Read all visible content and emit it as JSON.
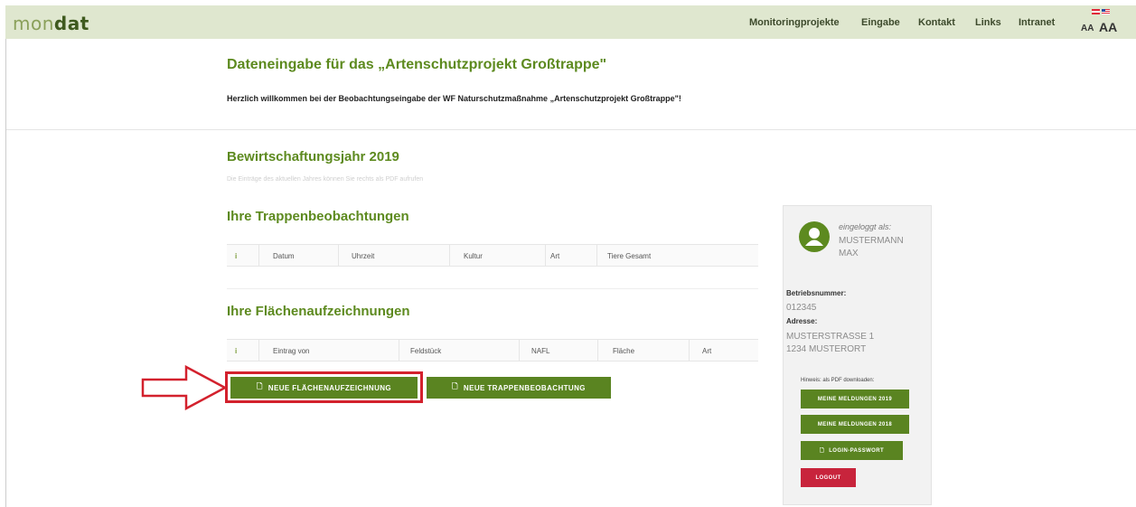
{
  "colors": {
    "accent": "#5d8a1f",
    "button": "#5a8421",
    "logout": "#c8243c",
    "highlight": "#d3212d",
    "topbar": "#dfe7cf"
  },
  "logo": {
    "part1": "mon",
    "part2": "dat"
  },
  "nav": [
    "Monitoringprojekte",
    "Eingabe",
    "Kontakt",
    "Links",
    "Intranet"
  ],
  "font_size": {
    "small": "AA",
    "large": "AA"
  },
  "header": {
    "title": "Dateneingabe für das „Artenschutzprojekt Großtrappe\"",
    "welcome": "Herzlich willkommen bei der Beobachtungseingabe der WF Naturschutzmaßnahme „Artenschutzprojekt Großtrappe\"!"
  },
  "main": {
    "year_title": "Bewirtschaftungsjahr 2019",
    "hint": "Die Einträge des aktuellen Jahres können Sie rechts als PDF aufrufen",
    "trappen": {
      "title": "Ihre Trappenbeobachtungen",
      "columns": [
        "i",
        "Datum",
        "Uhrzeit",
        "Kultur",
        "Art",
        "Tiere Gesamt"
      ]
    },
    "flaechen": {
      "title": "Ihre Flächenaufzeichnungen",
      "columns": [
        "i",
        "Eintrag von",
        "Feldstück",
        "NAFL",
        "Fläche",
        "Art"
      ]
    },
    "buttons": {
      "new_area": "NEUE FLÄCHENAUFZEICHNUNG",
      "new_bustard": "NEUE TRAPPENBEOBACHTUNG",
      "icon_glyph": "🗋"
    }
  },
  "sidebar": {
    "logged_in_label": "eingeloggt als:",
    "user_line1": "MUSTERMANN",
    "user_line2": "MAX",
    "betriebsnummer_label": "Betriebsnummer:",
    "betriebsnummer": "012345",
    "adresse_label": "Adresse:",
    "adresse_line1": "MUSTERSTRASSE 1",
    "adresse_line2": "1234 MUSTERORT",
    "pdf_hint": "Hinweis: als PDF downloaden:",
    "btn_2019": "MEINE MELDUNGEN 2019",
    "btn_2018": "MEINE MELDUNGEN 2018",
    "btn_password": "LOGIN-PASSWORT",
    "btn_logout": "LOGOUT"
  }
}
